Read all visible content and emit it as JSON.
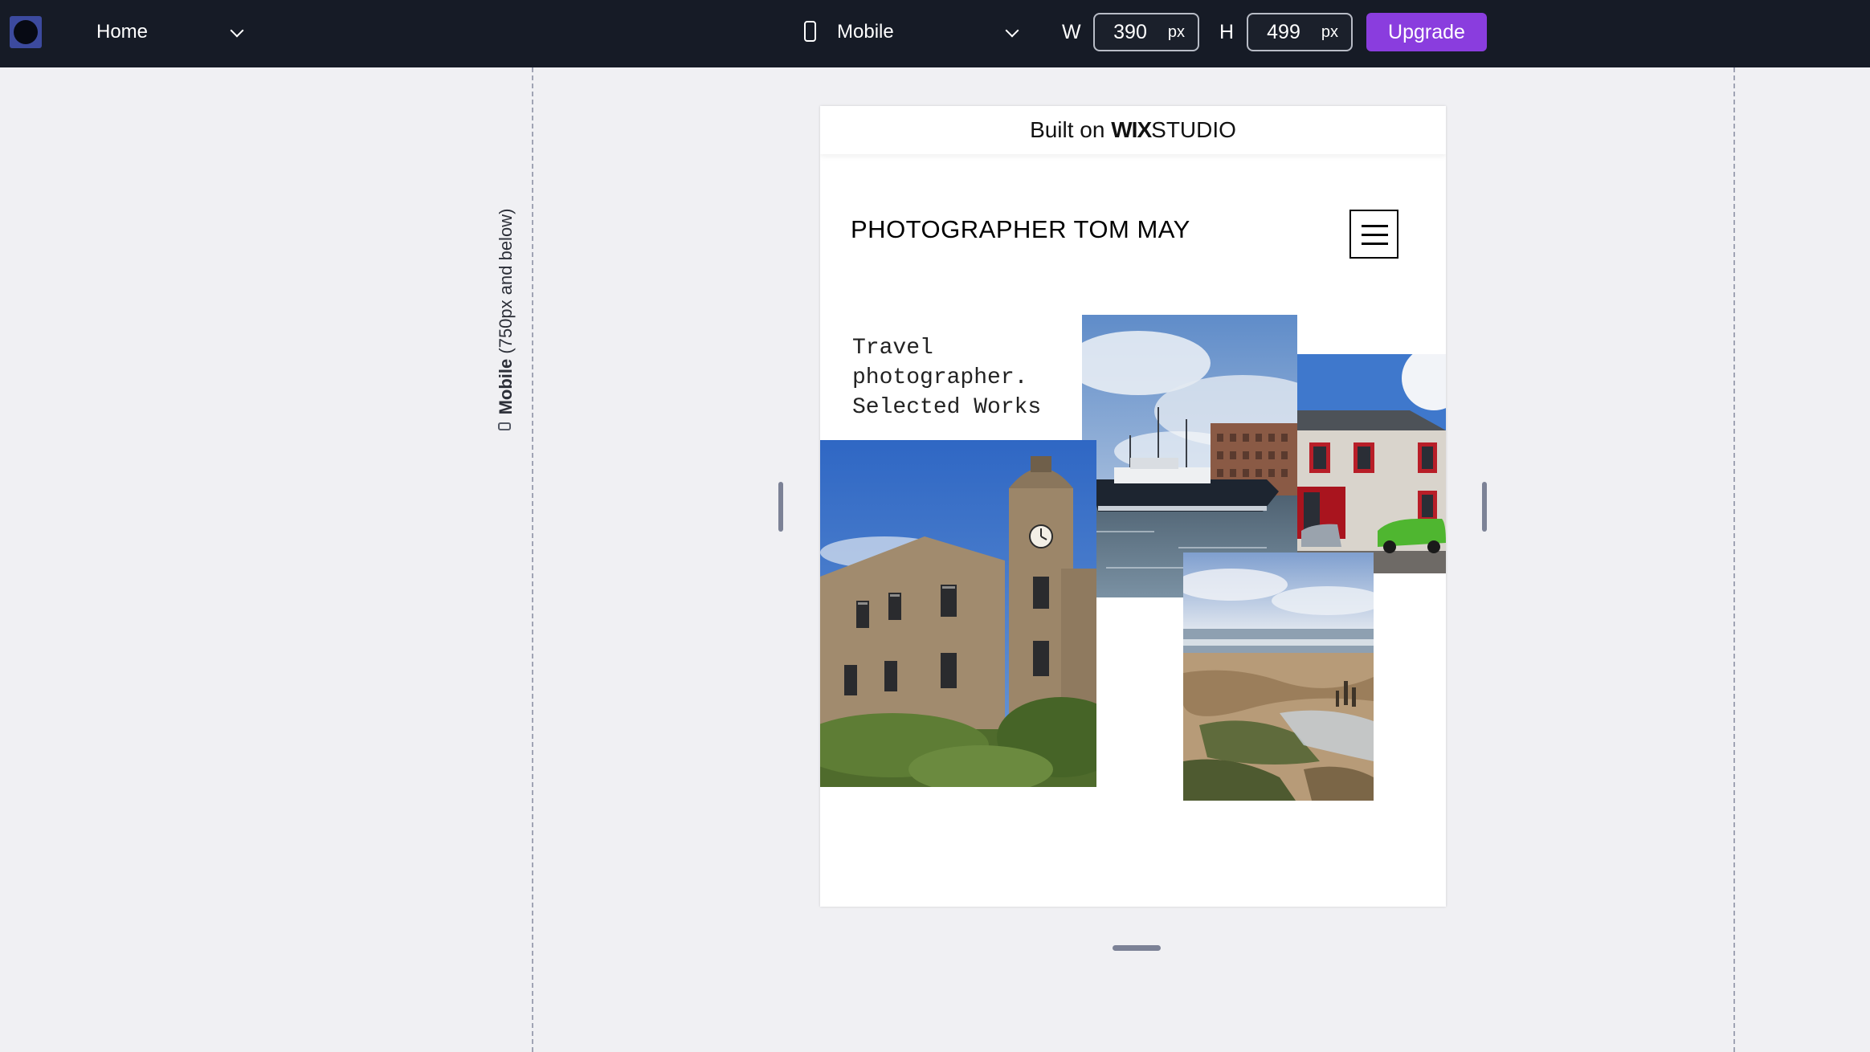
{
  "toolbar": {
    "page_select": "Home",
    "device_label": "Mobile",
    "width_label": "W",
    "width_value": "390",
    "width_unit": "px",
    "height_label": "H",
    "height_value": "499",
    "height_unit": "px",
    "upgrade_label": "Upgrade"
  },
  "breakpoint": {
    "label_bold": "Mobile",
    "label_range": "(750px and below)"
  },
  "site": {
    "built_on_prefix": "Built on",
    "brand_bold": "WIX",
    "brand_rest": "STUDIO",
    "title": "PHOTOGRAPHER TOM MAY",
    "tagline": [
      "Travel",
      "photographer.",
      "Selected Works"
    ]
  },
  "gallery": [
    {
      "name": "clock-tower-building-photo",
      "subject": "clock tower building"
    },
    {
      "name": "harbour-boats-photo",
      "subject": "harbour with boats"
    },
    {
      "name": "red-window-house-photo",
      "subject": "house with red windows"
    },
    {
      "name": "rocky-beach-photo",
      "subject": "rocky beach"
    }
  ],
  "colors": {
    "toolbar_bg": "#161b26",
    "upgrade_bg": "#8a3dde",
    "canvas_bg": "#f0f0f3"
  }
}
